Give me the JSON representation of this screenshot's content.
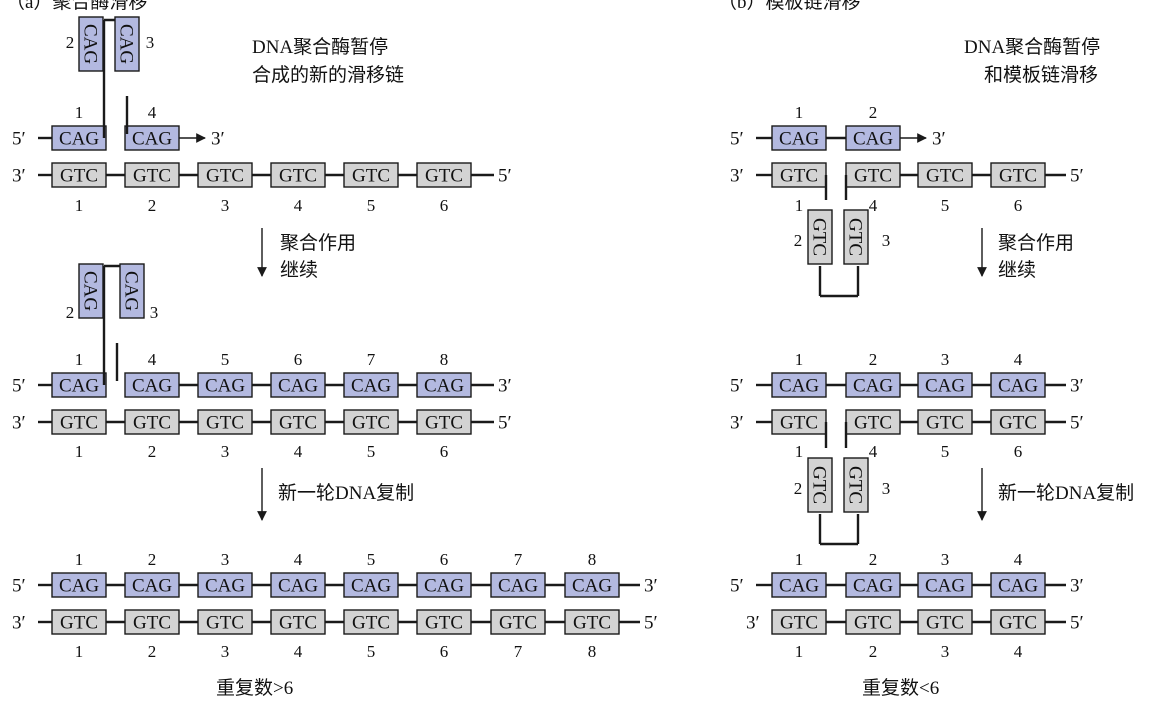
{
  "panel_a": {
    "header": "（a）聚合酶滑移",
    "note_line1": "DNA聚合酶暂停",
    "note_line2": "合成的新的滑移链",
    "step1": {
      "top": [
        "1",
        "4"
      ],
      "loop": [
        "2",
        "3"
      ],
      "bottom": [
        "1",
        "2",
        "3",
        "4",
        "5",
        "6"
      ],
      "top_unit": "CAG",
      "bottom_unit": "GTC"
    },
    "arrow1_line1": "聚合作用",
    "arrow1_line2": "继续",
    "step2": {
      "top": [
        "1",
        "4",
        "5",
        "6",
        "7",
        "8"
      ],
      "loop": [
        "2",
        "3"
      ],
      "bottom": [
        "1",
        "2",
        "3",
        "4",
        "5",
        "6"
      ]
    },
    "arrow2_label": "新一轮DNA复制",
    "step3": {
      "top": [
        "1",
        "2",
        "3",
        "4",
        "5",
        "6",
        "7",
        "8"
      ],
      "bottom": [
        "1",
        "2",
        "3",
        "4",
        "5",
        "6",
        "7",
        "8"
      ]
    },
    "summary": "重复数>6"
  },
  "panel_b": {
    "header": "（b）模板链滑移",
    "note_line1": "DNA聚合酶暂停",
    "note_line2": "和模板链滑移",
    "step1": {
      "top": [
        "1",
        "2"
      ],
      "bottom": [
        "1",
        "4",
        "5",
        "6"
      ],
      "loop": [
        "2",
        "3"
      ]
    },
    "arrow1_line1": "聚合作用",
    "arrow1_line2": "继续",
    "step2": {
      "top": [
        "1",
        "2",
        "3",
        "4"
      ],
      "bottom": [
        "1",
        "4",
        "5",
        "6"
      ],
      "loop": [
        "2",
        "3"
      ]
    },
    "arrow2_label": "新一轮DNA复制",
    "step3": {
      "top": [
        "1",
        "2",
        "3",
        "4"
      ],
      "bottom": [
        "1",
        "2",
        "3",
        "4"
      ]
    },
    "summary": "重复数<6"
  },
  "units": {
    "cag": "CAG",
    "gtc": "GTC"
  },
  "ends": {
    "five": "5′",
    "three": "3′"
  },
  "colors": {
    "cag_fill": "#b3b9e0",
    "gtc_fill": "#d3d3d3",
    "line": "#1a1a1a"
  }
}
